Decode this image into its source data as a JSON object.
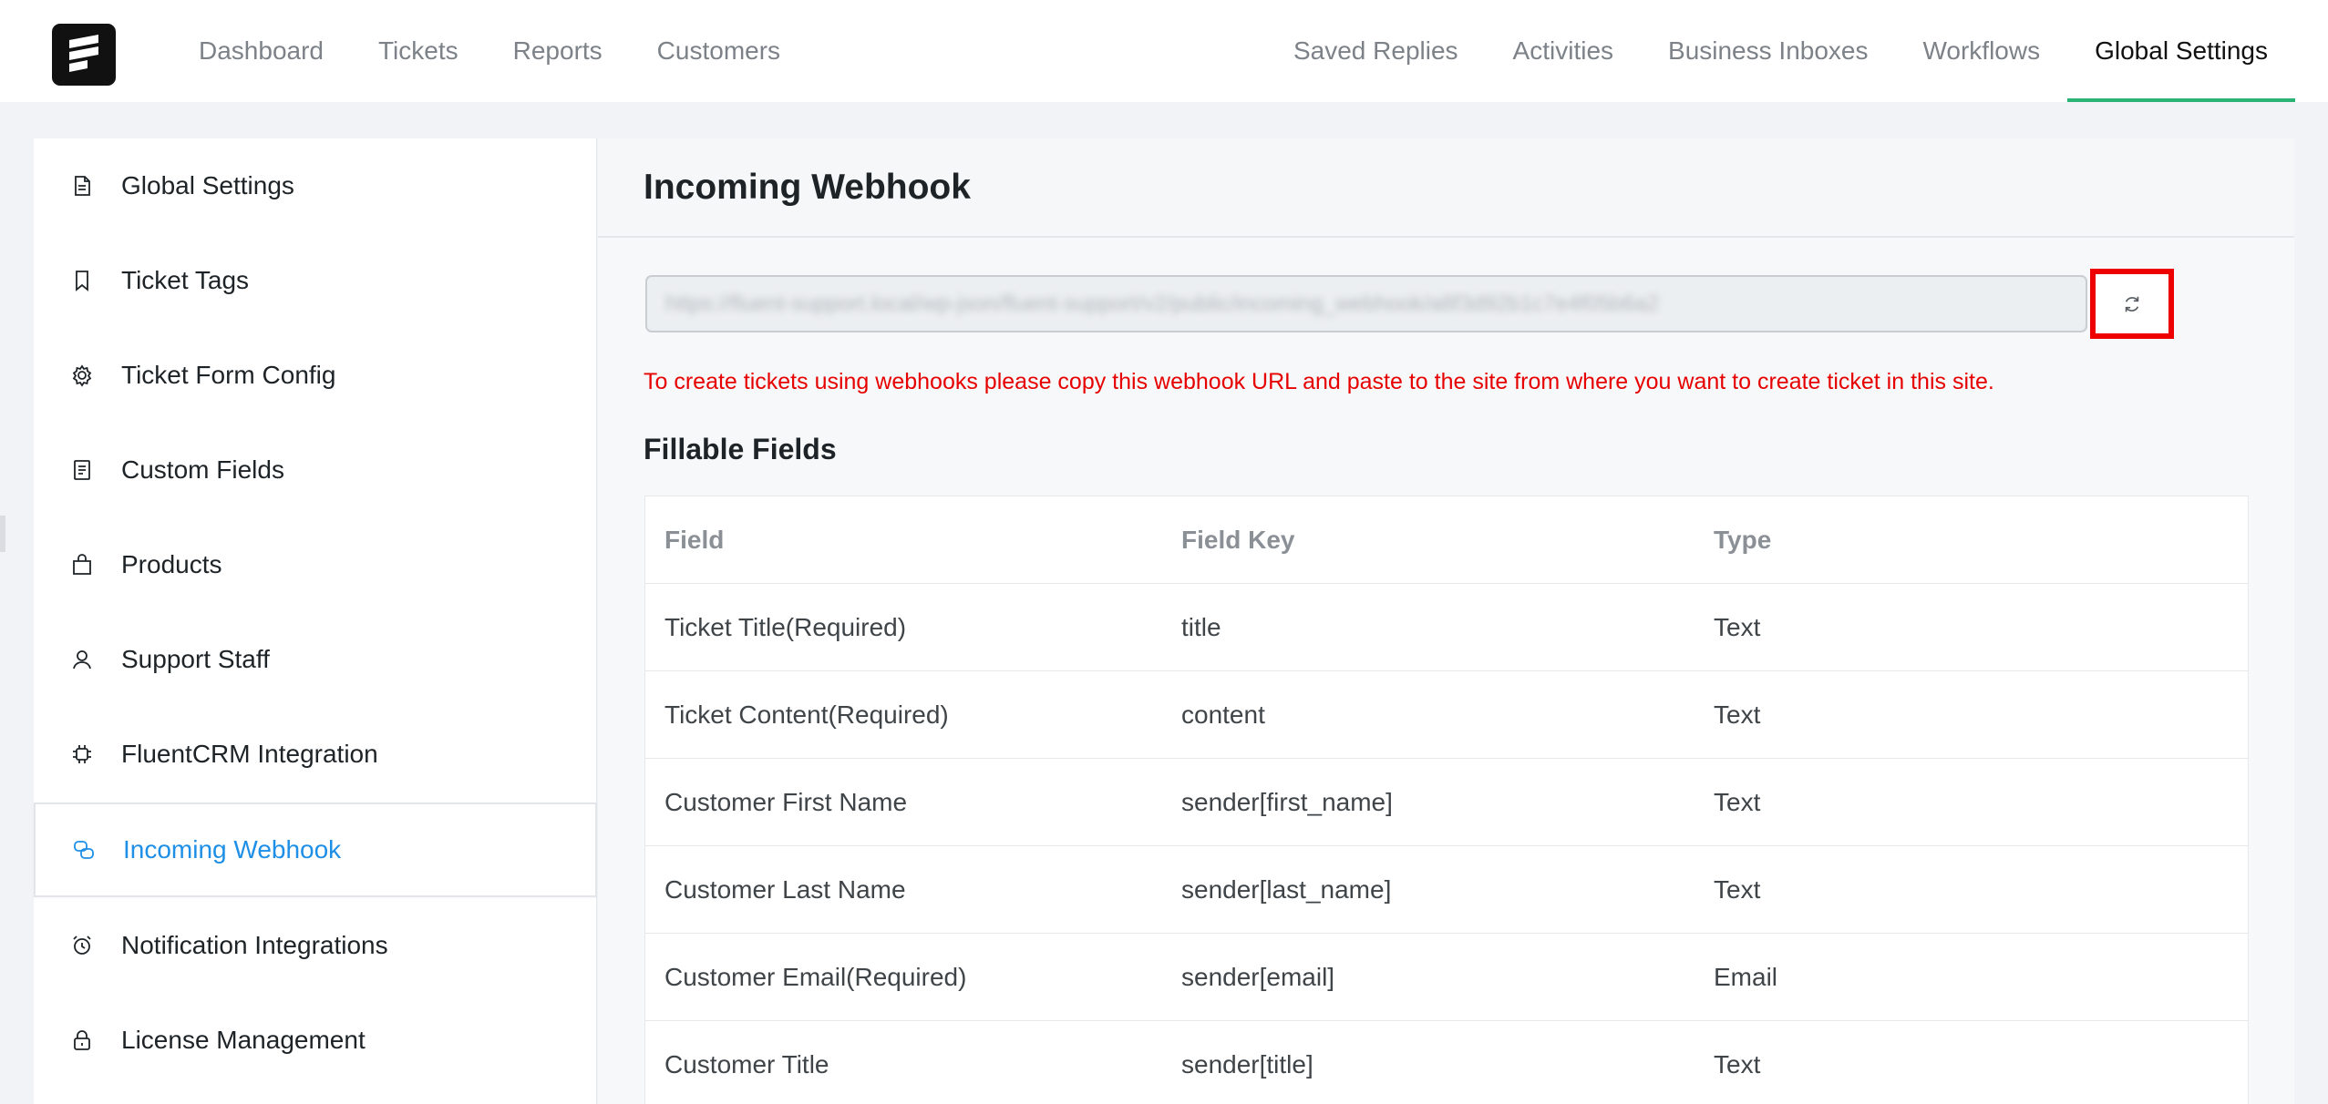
{
  "nav": {
    "left": [
      "Dashboard",
      "Tickets",
      "Reports",
      "Customers"
    ],
    "right": [
      "Saved Replies",
      "Activities",
      "Business Inboxes",
      "Workflows",
      "Global Settings"
    ],
    "active": "Global Settings"
  },
  "sidebar": {
    "items": [
      {
        "label": "Global Settings",
        "icon": "document-icon"
      },
      {
        "label": "Ticket Tags",
        "icon": "bookmark-icon"
      },
      {
        "label": "Ticket Form Config",
        "icon": "gear-icon"
      },
      {
        "label": "Custom Fields",
        "icon": "list-document-icon"
      },
      {
        "label": "Products",
        "icon": "shopping-bag-icon"
      },
      {
        "label": "Support Staff",
        "icon": "user-icon"
      },
      {
        "label": "FluentCRM Integration",
        "icon": "chip-icon"
      },
      {
        "label": "Incoming Webhook",
        "icon": "webhook-icon"
      },
      {
        "label": "Notification Integrations",
        "icon": "alarm-clock-icon"
      },
      {
        "label": "License Management",
        "icon": "lock-icon"
      }
    ],
    "active": "Incoming Webhook"
  },
  "main": {
    "title": "Incoming Webhook",
    "webhook_url": "https://fluent-support.local/wp-json/fluent-support/v2/public/incoming_webhook/a8f3d92b1c7e4f05b6a2",
    "hint": "To create tickets using webhooks please copy this webhook URL and paste to the site from where you want to create ticket in this site.",
    "section_title": "Fillable Fields",
    "table": {
      "headers": [
        "Field",
        "Field Key",
        "Type"
      ],
      "rows": [
        [
          "Ticket Title(Required)",
          "title",
          "Text"
        ],
        [
          "Ticket Content(Required)",
          "content",
          "Text"
        ],
        [
          "Customer First Name",
          "sender[first_name]",
          "Text"
        ],
        [
          "Customer Last Name",
          "sender[last_name]",
          "Text"
        ],
        [
          "Customer Email(Required)",
          "sender[email]",
          "Email"
        ],
        [
          "Customer Title",
          "sender[title]",
          "Text"
        ]
      ]
    }
  },
  "colors": {
    "accent": "#2ab374",
    "link_active": "#1e8fe6",
    "alert": "#e60000"
  }
}
